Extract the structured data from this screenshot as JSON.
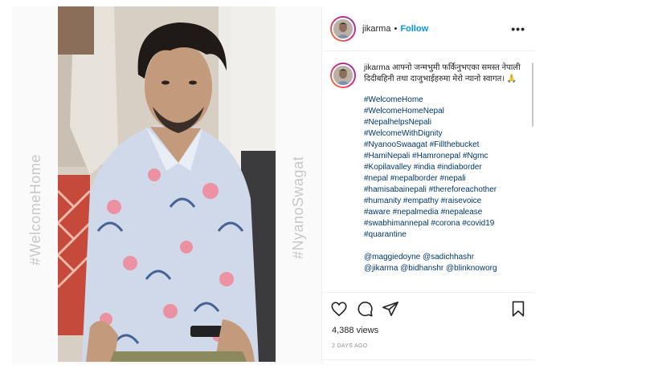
{
  "overlay": {
    "left_text": "#WelcomeHome",
    "right_text": "#NyanoSwagat"
  },
  "post": {
    "username": "jikarma",
    "dot": "•",
    "follow_label": "Follow",
    "more_label": "•••"
  },
  "caption": {
    "username": "jikarma",
    "text": "आफ्नो जन्मभुमी फर्किनुभएका समस्त नेपाली दिदीबहिनी तथा दाजुभाईहरुमा मेरो न्यानो स्वागत। 🙏",
    "hashtags": [
      "#WelcomeHome",
      "#WelcomeHomeNepal",
      "#NepalhelpsNepali",
      "#WelcomeWithDignity",
      "#NyanooSwaagat #Fillthebucket",
      "#HamiNepali #Hamronepal #Ngmc",
      "#Kopilavalley #india #indiaborder",
      "#nepal #nepalborder #nepali",
      "#hamisabainepali #thereforeachother",
      "#humanity #empathy #raisevoice",
      "#aware #nepalmedia #nepalease",
      "#swabhimannepal #corona #covid19",
      "#quarantine"
    ],
    "mentions": [
      "@maggiedoyne @sadichhashr",
      "@jikarma @bidhanshr @blinknoworg"
    ]
  },
  "stats": {
    "views": "4,388 views",
    "time_ago": "2 DAYS AGO"
  },
  "icons": {
    "like": "heart-icon",
    "comment": "comment-icon",
    "share": "share-icon",
    "save": "bookmark-icon"
  },
  "colors": {
    "link": "#00376b",
    "follow": "#0095f6",
    "overlay_text": "#c7c7c7"
  }
}
